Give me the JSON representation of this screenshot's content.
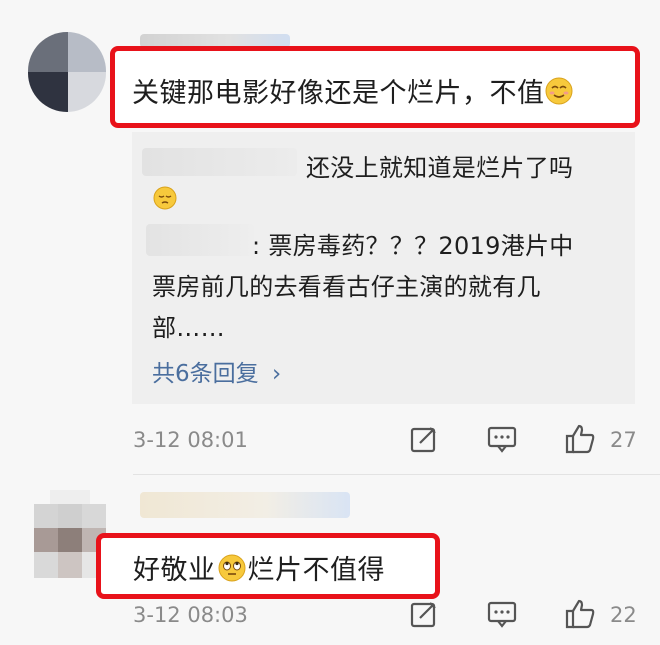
{
  "comments": [
    {
      "text": "关键那电影好像还是个烂片，不值",
      "time": "3-12 08:01",
      "likes": "27",
      "replies": {
        "reply1": "还没上就知道是烂片了吗",
        "reply2_line1": ": 票房毒药？？？2019港片中",
        "reply2_line2": "票房前几的去看看古仔主演的就有几",
        "reply2_line3": "部……",
        "more": "共6条回复 ",
        "more_chevron": "›"
      }
    },
    {
      "text_before": "好敬业",
      "text_after": "烂片不值得",
      "time": "3-12 08:03",
      "likes": "22"
    }
  ],
  "icons": [
    "compose-icon",
    "comment-icon",
    "thumbs-up-icon"
  ],
  "colors": {
    "highlight": "#e8121a",
    "link": "#4a6e9e",
    "meta": "#8a8a8a"
  }
}
